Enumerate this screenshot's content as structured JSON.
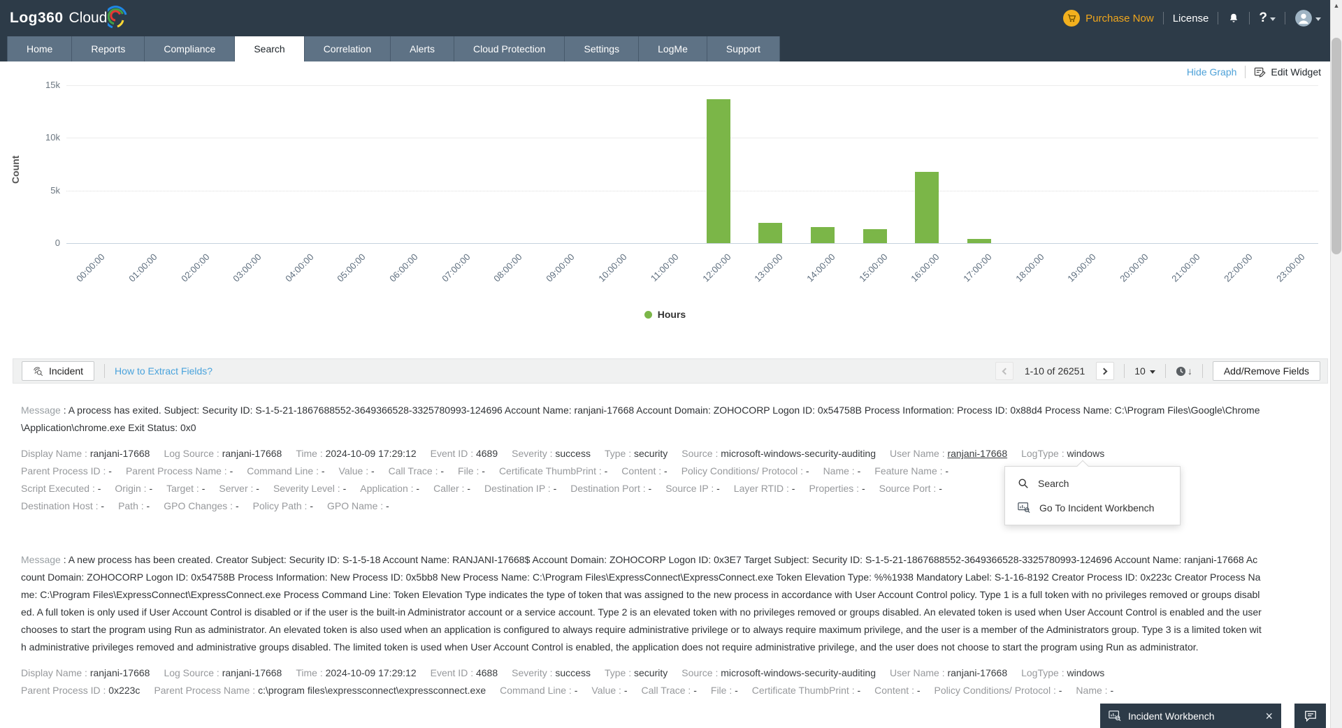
{
  "header": {
    "logo_primary": "Log360",
    "logo_secondary": "Cloud",
    "purchase_now": "Purchase Now",
    "license": "License",
    "help": "?"
  },
  "nav": {
    "active_tab": "Search",
    "tabs": [
      "Home",
      "Reports",
      "Compliance",
      "Search",
      "Correlation",
      "Alerts",
      "Cloud Protection",
      "Settings",
      "LogMe",
      "Support"
    ]
  },
  "graph_controls": {
    "hide_graph": "Hide Graph",
    "edit_widget": "Edit Widget"
  },
  "chart_data": {
    "type": "bar",
    "title": "",
    "xlabel": "",
    "ylabel": "Count",
    "ylim": [
      0,
      15000
    ],
    "grid": true,
    "legend_position": "bottom",
    "bar_color": "#7bb648",
    "categories": [
      "00:00:00",
      "01:00:00",
      "02:00:00",
      "03:00:00",
      "04:00:00",
      "05:00:00",
      "06:00:00",
      "07:00:00",
      "08:00:00",
      "09:00:00",
      "10:00:00",
      "11:00:00",
      "12:00:00",
      "13:00:00",
      "14:00:00",
      "15:00:00",
      "16:00:00",
      "17:00:00",
      "18:00:00",
      "19:00:00",
      "20:00:00",
      "21:00:00",
      "22:00:00",
      "23:00:00"
    ],
    "values": [
      0,
      0,
      0,
      0,
      0,
      0,
      0,
      0,
      0,
      0,
      0,
      0,
      13700,
      1900,
      1500,
      1300,
      6800,
      400,
      0,
      0,
      0,
      0,
      0,
      0
    ],
    "yticks": [
      {
        "value": 0,
        "label": "0",
        "style": "axis"
      },
      {
        "value": 5000,
        "label": "5k",
        "style": "dotted"
      },
      {
        "value": 10000,
        "label": "10k",
        "style": "solid"
      },
      {
        "value": 15000,
        "label": "15k",
        "style": "solid"
      }
    ],
    "legend": [
      {
        "label": "Hours",
        "color": "#7bb648"
      }
    ]
  },
  "toolbar": {
    "incident_label": "Incident",
    "how_to_extract": "How to Extract Fields?",
    "pagination": {
      "range": "1-10 of 26251",
      "page_size": "10"
    },
    "add_remove_fields": "Add/Remove Fields"
  },
  "records": [
    {
      "message_label": "Message",
      "message": "A process has exited. Subject: Security ID: S-1-5-21-1867688552-3649366528-3325780993-124696 Account Name: ranjani-17668 Account Domain: ZOHOCORP Logon ID: 0x54758B Process Information: Process ID: 0x88d4 Process Name: C:\\Program Files\\Google\\Chrome\\Application\\chrome.exe Exit Status: 0x0",
      "field_rows": [
        [
          {
            "l": "Display Name",
            "v": "ranjani-17668"
          },
          {
            "l": "Log Source",
            "v": "ranjani-17668"
          },
          {
            "l": "Time",
            "v": "2024-10-09 17:29:12"
          },
          {
            "l": "Event ID",
            "v": "4689"
          },
          {
            "l": "Severity",
            "v": "success"
          },
          {
            "l": "Type",
            "v": "security"
          },
          {
            "l": "Source",
            "v": "microsoft-windows-security-auditing"
          },
          {
            "l": "User Name",
            "v": "ranjani-17668",
            "link": true
          },
          {
            "l": "LogType",
            "v": "windows"
          }
        ],
        [
          {
            "l": "Parent Process ID",
            "v": "-"
          },
          {
            "l": "Parent Process Name",
            "v": "-"
          },
          {
            "l": "Command Line",
            "v": "-"
          },
          {
            "l": "Value",
            "v": "-"
          },
          {
            "l": "Call Trace",
            "v": "-"
          },
          {
            "l": "File",
            "v": "-"
          },
          {
            "l": "Certificate ThumbPrint",
            "v": "-"
          },
          {
            "l": "Content",
            "v": "-"
          },
          {
            "l": "Policy Conditions/ Protocol",
            "v": "-"
          },
          {
            "l": "Name",
            "v": "-"
          },
          {
            "l": "Feature Name",
            "v": "-"
          }
        ],
        [
          {
            "l": "Script Executed",
            "v": "-"
          },
          {
            "l": "Origin",
            "v": "-"
          },
          {
            "l": "Target",
            "v": "-"
          },
          {
            "l": "Server",
            "v": "-"
          },
          {
            "l": "Severity Level",
            "v": "-"
          },
          {
            "l": "Application",
            "v": "-"
          },
          {
            "l": "Caller",
            "v": "-"
          },
          {
            "l": "Destination IP",
            "v": "-"
          },
          {
            "l": "Destination Port",
            "v": "-"
          },
          {
            "l": "Source IP",
            "v": "-"
          },
          {
            "l": "Layer RTID",
            "v": "-"
          },
          {
            "l": "Properties",
            "v": "-"
          },
          {
            "l": "Source Port",
            "v": "-"
          }
        ],
        [
          {
            "l": "Destination Host",
            "v": "-"
          },
          {
            "l": "Path",
            "v": "-"
          },
          {
            "l": "GPO Changes",
            "v": "-"
          },
          {
            "l": "Policy Path",
            "v": "-"
          },
          {
            "l": "GPO Name",
            "v": "-"
          }
        ]
      ]
    },
    {
      "message_label": "Message",
      "message": "A new process has been created. Creator Subject: Security ID: S-1-5-18 Account Name: RANJANI-17668$ Account Domain: ZOHOCORP Logon ID: 0x3E7 Target Subject: Security ID: S-1-5-21-1867688552-3649366528-3325780993-124696 Account Name: ranjani-17668 Account Domain: ZOHOCORP Logon ID: 0x54758B Process Information: New Process ID: 0x5bb8 New Process Name: C:\\Program Files\\ExpressConnect\\ExpressConnect.exe Token Elevation Type: %%1938 Mandatory Label: S-1-16-8192 Creator Process ID: 0x223c Creator Process Name: C:\\Program Files\\ExpressConnect\\ExpressConnect.exe Process Command Line: Token Elevation Type indicates the type of token that was assigned to the new process in accordance with User Account Control policy. Type 1 is a full token with no privileges removed or groups disabled. A full token is only used if User Account Control is disabled or if the user is the built-in Administrator account or a service account. Type 2 is an elevated token with no privileges removed or groups disabled. An elevated token is used when User Account Control is enabled and the user chooses to start the program using Run as administrator. An elevated token is also used when an application is configured to always require administrative privilege or to always require maximum privilege, and the user is a member of the Administrators group. Type 3 is a limited token with administrative privileges removed and administrative groups disabled. The limited token is used when User Account Control is enabled, the application does not require administrative privilege, and the user does not choose to start the program using Run as administrator.",
      "field_rows": [
        [
          {
            "l": "Display Name",
            "v": "ranjani-17668"
          },
          {
            "l": "Log Source",
            "v": "ranjani-17668"
          },
          {
            "l": "Time",
            "v": "2024-10-09 17:29:12"
          },
          {
            "l": "Event ID",
            "v": "4688"
          },
          {
            "l": "Severity",
            "v": "success"
          },
          {
            "l": "Type",
            "v": "security"
          },
          {
            "l": "Source",
            "v": "microsoft-windows-security-auditing"
          },
          {
            "l": "User Name",
            "v": "ranjani-17668"
          },
          {
            "l": "LogType",
            "v": "windows"
          }
        ],
        [
          {
            "l": "Parent Process ID",
            "v": "0x223c"
          },
          {
            "l": "Parent Process Name",
            "v": "c:\\program files\\expressconnect\\expressconnect.exe"
          },
          {
            "l": "Command Line",
            "v": "-"
          },
          {
            "l": "Value",
            "v": "-"
          },
          {
            "l": "Call Trace",
            "v": "-"
          },
          {
            "l": "File",
            "v": "-"
          },
          {
            "l": "Certificate ThumbPrint",
            "v": "-"
          },
          {
            "l": "Content",
            "v": "-"
          },
          {
            "l": "Policy Conditions/ Protocol",
            "v": "-"
          },
          {
            "l": "Name",
            "v": "-"
          }
        ]
      ]
    }
  ],
  "context_menu": {
    "items": [
      {
        "icon": "search-icon",
        "label": "Search"
      },
      {
        "icon": "workbench-icon",
        "label": "Go To Incident Workbench"
      }
    ]
  },
  "workbench": {
    "title": "Incident Workbench",
    "close_label": "×"
  }
}
